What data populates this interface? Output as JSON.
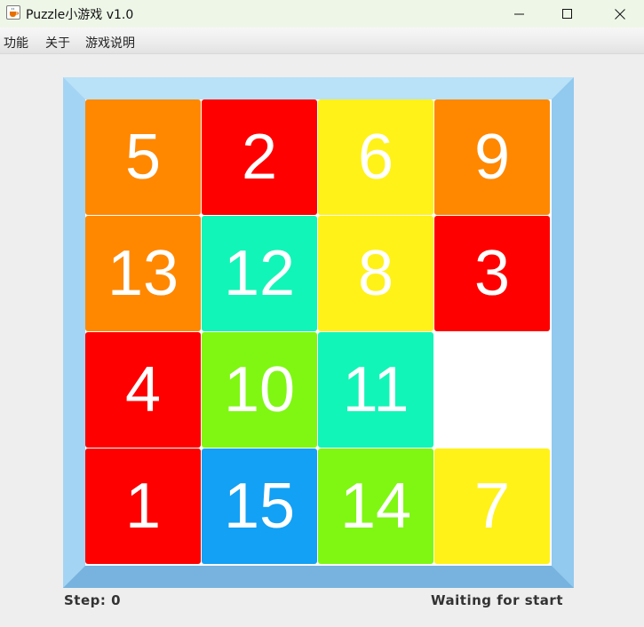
{
  "window": {
    "title": "Puzzle小游戏 v1.0",
    "icon": "java-cup-icon",
    "controls": [
      "minimize-icon",
      "maximize-icon",
      "close-icon"
    ]
  },
  "menu": {
    "items": [
      "功能",
      "关于",
      "游戏说明"
    ]
  },
  "board": {
    "rows": 4,
    "cols": 4,
    "empty_cell": [
      2,
      3
    ],
    "tiles": [
      {
        "number": "5",
        "color": "#ff8800"
      },
      {
        "number": "2",
        "color": "#ff0000"
      },
      {
        "number": "6",
        "color": "#fff218"
      },
      {
        "number": "9",
        "color": "#ff8800"
      },
      {
        "number": "13",
        "color": "#ff8800"
      },
      {
        "number": "12",
        "color": "#12f5b8"
      },
      {
        "number": "8",
        "color": "#fff218"
      },
      {
        "number": "3",
        "color": "#ff0000"
      },
      {
        "number": "4",
        "color": "#ff0000"
      },
      {
        "number": "10",
        "color": "#7ff712"
      },
      {
        "number": "11",
        "color": "#12f5b8"
      },
      {
        "number": "",
        "color": "#ffffff"
      },
      {
        "number": "1",
        "color": "#ff0000"
      },
      {
        "number": "15",
        "color": "#12a1f4"
      },
      {
        "number": "14",
        "color": "#7ff712"
      },
      {
        "number": "7",
        "color": "#fff218"
      }
    ]
  },
  "status": {
    "step_label": "Step: 0",
    "state_label": "Waiting for start"
  }
}
